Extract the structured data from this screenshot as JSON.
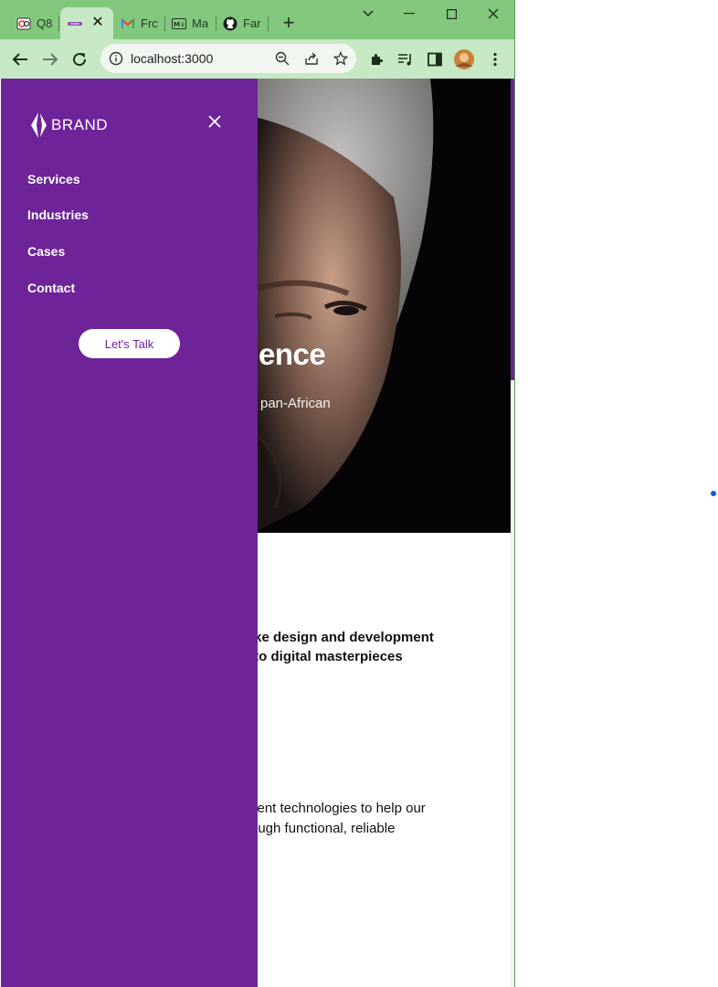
{
  "browser": {
    "tabs": [
      {
        "label": "Q8",
        "icon": "qa-icon"
      },
      {
        "label": "",
        "icon": "brand-favicon",
        "close": "✕"
      },
      {
        "label": "Frc",
        "icon": "gmail-icon"
      },
      {
        "label": "Ma",
        "icon": "markdown-icon"
      },
      {
        "label": "Far",
        "icon": "github-icon"
      }
    ],
    "new_tab": "+",
    "url": "localhost:3000"
  },
  "drawer": {
    "logo_text": "BRAND",
    "nav": [
      "Services",
      "Industries",
      "Cases",
      "Contact"
    ],
    "cta": "Let's Talk"
  },
  "hero": {
    "heading_fragment": "ence",
    "sub_fragment": "pan-African"
  },
  "content": {
    "line1": "oke design and development",
    "line2": "nto digital masterpieces",
    "line3": "ment technologies to help our",
    "line4": "rough functional, reliable"
  },
  "colors": {
    "brand_purple": "#6e2399",
    "tab_strip": "#82c77e",
    "toolbar": "#c7e8c4"
  }
}
